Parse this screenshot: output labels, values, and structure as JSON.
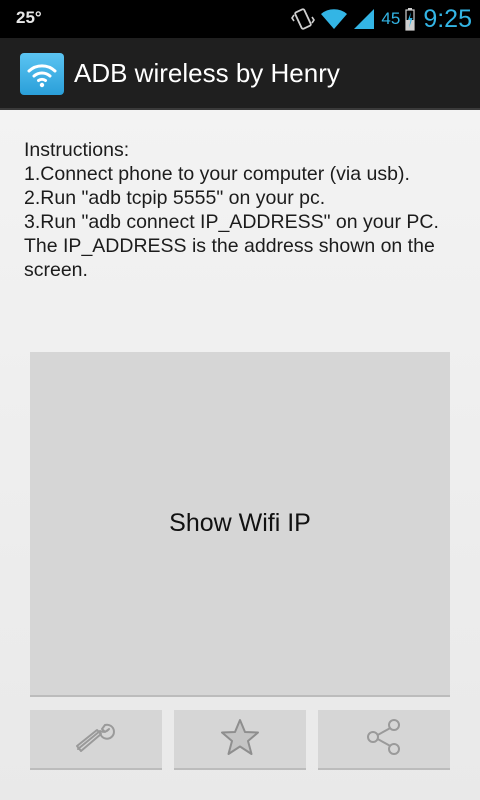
{
  "status_bar": {
    "temperature": "25°",
    "battery_level": "45",
    "clock": "9:25",
    "icons": [
      "vibrate-icon",
      "wifi-icon",
      "signal-icon",
      "battery-icon"
    ],
    "accent_color": "#33b5e5"
  },
  "action_bar": {
    "title": "ADB wireless by Henry",
    "icon": "wifi-app-icon"
  },
  "instructions": {
    "lines": [
      "Instructions:",
      "1.Connect phone to your computer (via usb).",
      "2.Run \"adb tcpip 5555\" on your pc.",
      "3.Run \"adb connect IP_ADDRESS\" on your PC.",
      "The IP_ADDRESS is the address shown on the",
      "screen."
    ]
  },
  "main_button": {
    "label": "Show Wifi IP"
  },
  "bottom_buttons": [
    {
      "icon": "wrench-icon"
    },
    {
      "icon": "star-icon"
    },
    {
      "icon": "share-icon"
    }
  ]
}
